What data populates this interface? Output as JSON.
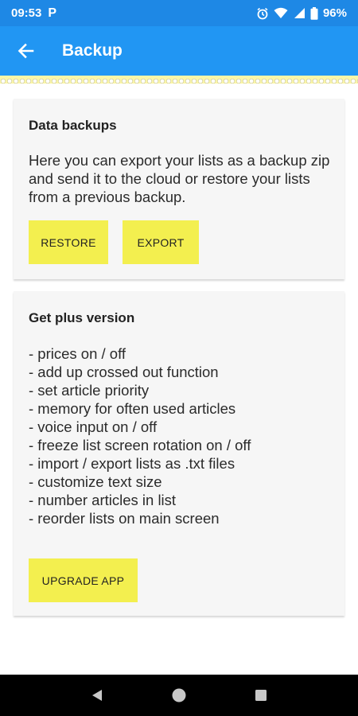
{
  "status_bar": {
    "time": "09:53",
    "notification_icon": "P",
    "battery": "96%",
    "icons": [
      "alarm-icon",
      "wifi-icon",
      "signal-icon",
      "battery-icon"
    ]
  },
  "app_bar": {
    "title": "Backup",
    "back_icon": "arrow-left-icon",
    "color": "#2196f3"
  },
  "backup_card": {
    "title": "Data backups",
    "text": "Here you can export your lists as a backup zip and send it to the cloud or restore your lists from a previous backup.",
    "restore_label": "RESTORE",
    "export_label": "EXPORT"
  },
  "plus_card": {
    "title": "Get plus version",
    "features": [
      "- prices on / off",
      "- add up crossed out function",
      "- set article priority",
      "- memory for often used articles",
      "- voice input on / off",
      "- freeze list screen rotation on / off",
      "- import / export lists as .txt files",
      "- customize text size",
      "- number articles in list",
      "- reorder lists on main screen"
    ],
    "upgrade_label": "UPGRADE APP"
  },
  "colors": {
    "button_yellow": "#f3ef4f",
    "card_bg": "#f6f6f6",
    "status_bar": "#1e88e5"
  },
  "nav_bar": {
    "icons": [
      "back-triangle-icon",
      "home-circle-icon",
      "recents-square-icon"
    ]
  }
}
